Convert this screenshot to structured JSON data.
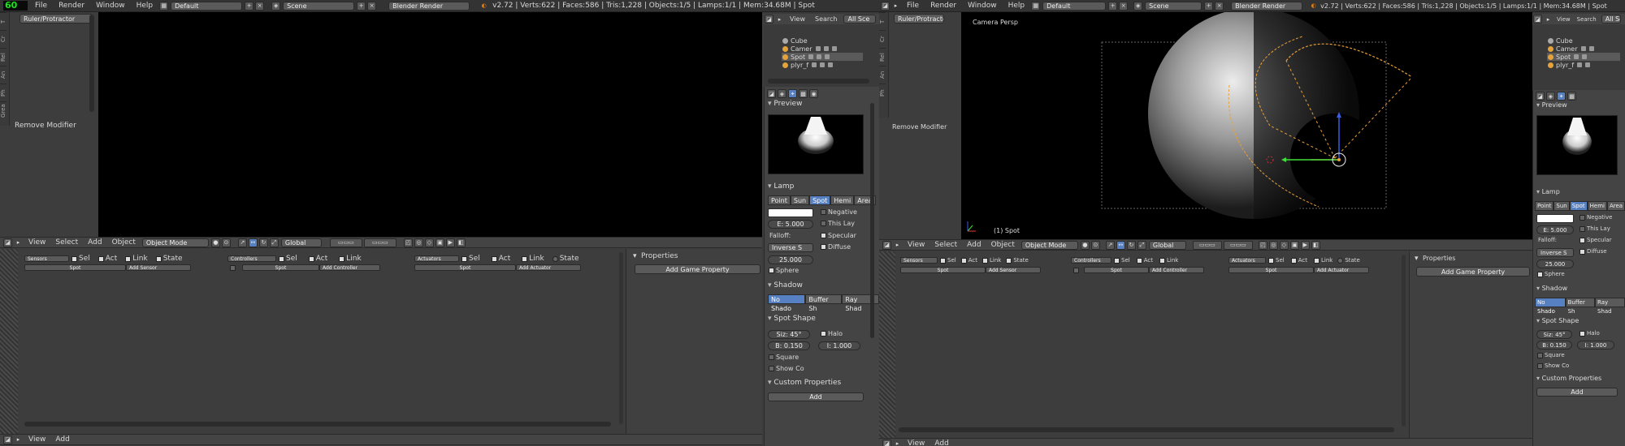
{
  "menus": [
    "File",
    "Render",
    "Window",
    "Help"
  ],
  "layout_field": "Default",
  "scene_field": "Scene",
  "render_engine": "Blender Render",
  "fps_counter": "60",
  "stats_left": "v2.72 | Verts:622 | Faces:586 | Tris:1,228 | Objects:1/5 | Lamps:1/1 | Mem:34.68M | Spot",
  "stats_right": "v2.72 | Verts:622 | Faces:586 | Tris:1,228 | Objects:1/5 | Lamps:1/1 | Mem:34.68M | Spot",
  "toolshelf": {
    "ruler_button": "Ruler/Protractor",
    "remove_modifier": "Remove Modifier",
    "tabs": [
      "T",
      "Cr",
      "Rel",
      "An",
      "Ph",
      "Grea"
    ]
  },
  "view3d_header": {
    "menus": [
      "View",
      "Select",
      "Add",
      "Object"
    ],
    "mode": "Object Mode",
    "orientation": "Global"
  },
  "viewport": {
    "camera_label": "Camera Persp",
    "object_label": "(1) Spot"
  },
  "logic": {
    "sensors": "Sensors",
    "controllers": "Controllers",
    "actuators": "Actuators",
    "sel": "Sel",
    "act": "Act",
    "link": "Link",
    "state": "State",
    "object_name": "Spot",
    "add_sensor": "Add Sensor",
    "add_controller": "Add Controller",
    "add_actuator": "Add Actuator",
    "properties_title": "Properties",
    "add_game_property": "Add Game Property"
  },
  "bottom_header": {
    "menus": [
      "View",
      "Add"
    ]
  },
  "outliner": {
    "menus": [
      "View",
      "Search"
    ],
    "filter": "All Sce",
    "items": [
      "Cube",
      "Camer",
      "Spot",
      "plyr_f"
    ]
  },
  "properties": {
    "preview": "Preview",
    "lamp": "Lamp",
    "lamp_types": [
      "Point",
      "Sun",
      "Spot",
      "Hemi",
      "Area"
    ],
    "negative": "Negative",
    "this_layer": "This Lay",
    "specular": "Specular",
    "diffuse": "Diffuse",
    "energy": "E: 5.000",
    "falloff_label": "Falloff:",
    "falloff": "Inverse S",
    "distance": "25.000",
    "sphere": "Sphere",
    "shadow": "Shadow",
    "shadow_types": [
      "No Shado",
      "Buffer Sh",
      "Ray Shad"
    ],
    "spot_shape": "Spot Shape",
    "size": "Siz: 45°",
    "halo": "Halo",
    "blend": "B: 0.150",
    "intensity": "I: 1.000",
    "square": "Square",
    "show_cone": "Show Co",
    "custom_props": "Custom Properties",
    "add": "Add"
  }
}
